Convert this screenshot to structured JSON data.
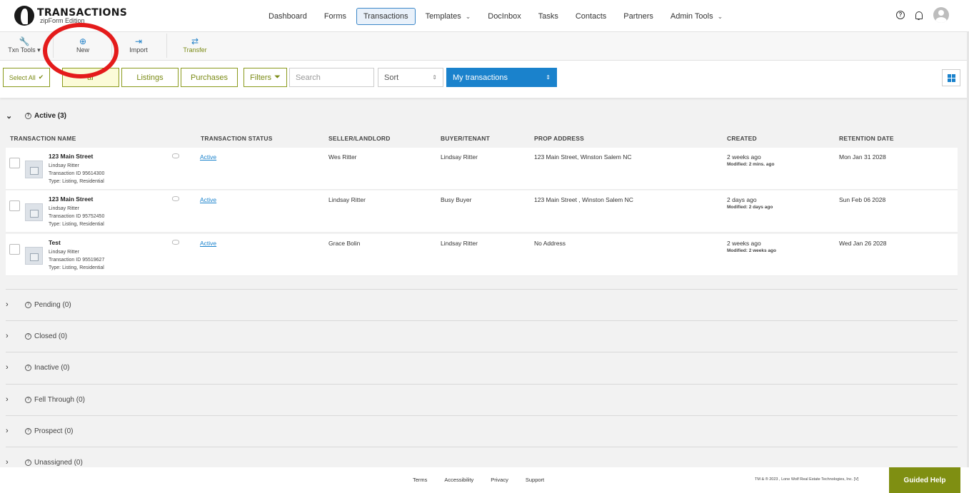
{
  "app": {
    "logo_title": "TRANSACTIONS",
    "logo_subtitle": "zipForm Edition"
  },
  "nav": {
    "items": [
      {
        "label": "Dashboard",
        "dropdown": false,
        "active": false
      },
      {
        "label": "Forms",
        "dropdown": false,
        "active": false
      },
      {
        "label": "Transactions",
        "dropdown": false,
        "active": true
      },
      {
        "label": "Templates",
        "dropdown": true,
        "active": false
      },
      {
        "label": "DocInbox",
        "dropdown": false,
        "active": false
      },
      {
        "label": "Tasks",
        "dropdown": false,
        "active": false
      },
      {
        "label": "Contacts",
        "dropdown": false,
        "active": false
      },
      {
        "label": "Partners",
        "dropdown": false,
        "active": false
      },
      {
        "label": "Admin Tools",
        "dropdown": true,
        "active": false
      }
    ],
    "help_glyph": "?"
  },
  "toolbar": {
    "txn_tools": "Txn Tools",
    "new": "New",
    "import": "Import",
    "transfer": "Transfer"
  },
  "filters": {
    "select_all": "Select All",
    "all_partial": "ar",
    "listings": "Listings",
    "purchases": "Purchases",
    "filters": "Filters",
    "search_placeholder": "Search",
    "sort": "Sort",
    "scope": "My transactions"
  },
  "groups": {
    "active": "Active (3)",
    "pending": "Pending (0)",
    "closed": "Closed (0)",
    "inactive": "Inactive (0)",
    "fell_through": "Fell Through (0)",
    "prospect": "Prospect (0)",
    "unassigned": "Unassigned (0)",
    "info_glyph": "?"
  },
  "table": {
    "headers": {
      "name": "TRANSACTION NAME",
      "status": "TRANSACTION STATUS",
      "seller": "SELLER/LANDLORD",
      "buyer": "BUYER/TENANT",
      "address": "PROP ADDRESS",
      "created": "CREATED",
      "retention": "RETENTION DATE"
    },
    "rows": [
      {
        "name": "123 Main Street",
        "agent": "Lindsay Ritter",
        "txn_id": "Transaction ID 95614300",
        "type": "Type: Listing, Residential",
        "status": "Active",
        "seller": "Wes Ritter",
        "buyer": "Lindsay Ritter",
        "address": "123 Main Street, Winston Salem NC",
        "created": "2 weeks ago",
        "modified": "Modified: 2 mins. ago",
        "retention": "Mon Jan 31 2028"
      },
      {
        "name": "123 Main Street",
        "agent": "Lindsay Ritter",
        "txn_id": "Transaction ID 95752450",
        "type": "Type: Listing, Residential",
        "status": "Active",
        "seller": "Lindsay Ritter",
        "buyer": "Busy Buyer",
        "address": "123 Main Street , Winston Salem NC",
        "created": "2 days ago",
        "modified": "Modified: 2 days ago",
        "retention": "Sun Feb 06 2028"
      },
      {
        "name": "Test",
        "agent": "Lindsay Ritter",
        "txn_id": "Transaction ID 95519627",
        "type": "Type: Listing, Residential",
        "status": "Active",
        "seller": "Grace Bolin",
        "buyer": "Lindsay Ritter",
        "address": "No Address",
        "created": "2 weeks ago",
        "modified": "Modified: 2 weeks ago",
        "retention": "Wed Jan 26 2028"
      }
    ]
  },
  "footer": {
    "terms": "Terms",
    "accessibility": "Accessibility",
    "privacy": "Privacy",
    "support": "Support",
    "copyright": "TM & ® 2023 , Lone Wolf Real Estate Technologies, Inc. [V]",
    "guided_help": "Guided Help"
  },
  "colors": {
    "accent_blue": "#1a82cc",
    "accent_green": "#7f8f12",
    "annotation_red": "#e41b1b"
  }
}
